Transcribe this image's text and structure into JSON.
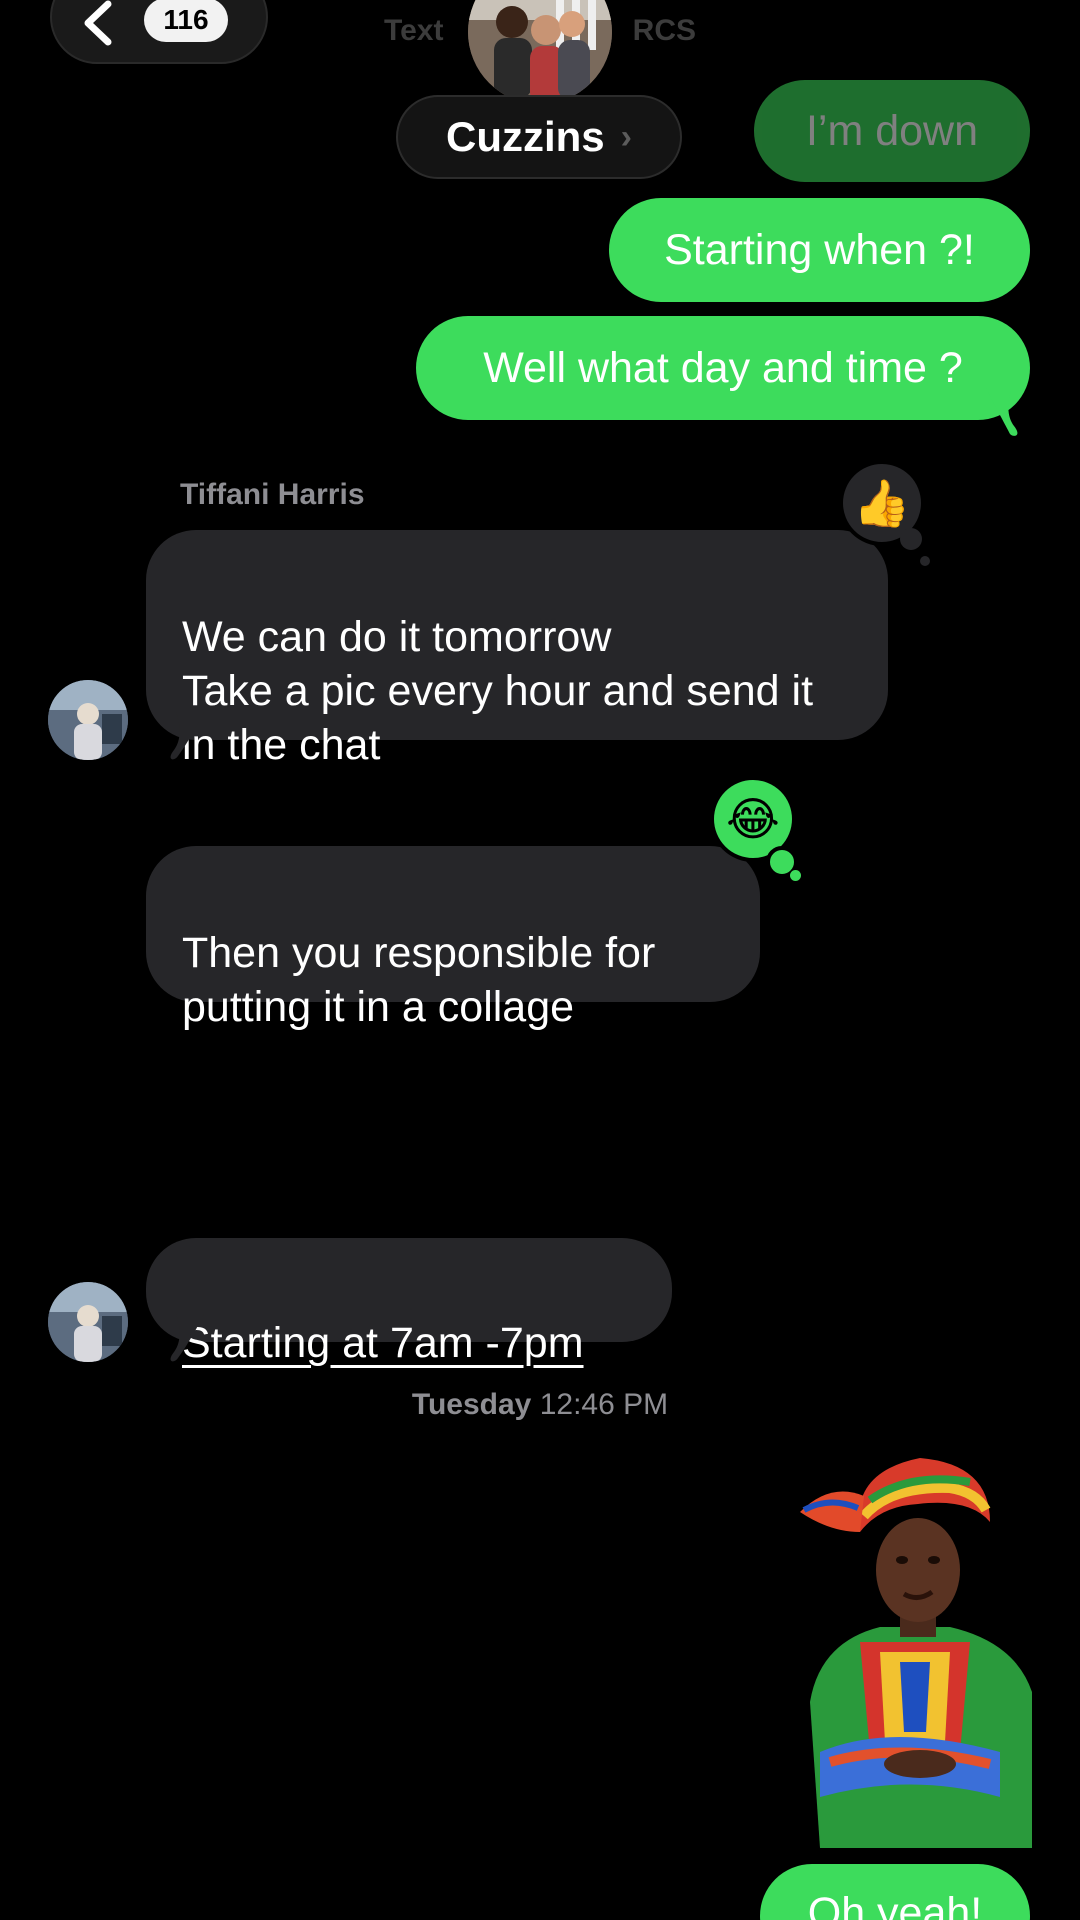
{
  "header": {
    "back_count": "116",
    "subtitle_left": "Text",
    "subtitle_right": "RCS",
    "title": "Cuzzins",
    "title_chevron": "›"
  },
  "messages": {
    "out1": "I’m down",
    "out2": "Starting when ?!",
    "out3": "Well what day and time ?",
    "sender_name": "Tiffani Harris",
    "in1": "We can do it tomorrow\nTake a pic every hour and send it in the chat",
    "in1_reaction": "👍",
    "in2": "Then you responsible for putting it in a collage",
    "in2_reaction": "😂",
    "in3_emoji": "😂😂",
    "in4": "Starting at 7am -7pm",
    "timestamp_day": "Tuesday",
    "timestamp_time": "12:46 PM",
    "out4": "Oh yeah!"
  },
  "icons": {
    "back": "chevron-left-icon",
    "title_chevron": "chevron-right-icon"
  },
  "colors": {
    "outgoing": "#3ddc5c",
    "incoming": "#262629",
    "background": "#000000",
    "meta_text": "#8e8e93"
  }
}
